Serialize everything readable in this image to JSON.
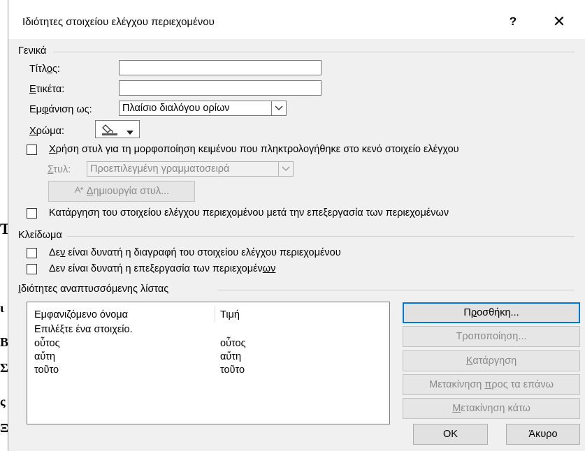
{
  "dialog": {
    "title": "Ιδιότητες στοιχείου ελέγχου περιεχομένου",
    "help_glyph": "?",
    "close_glyph": "✕"
  },
  "general": {
    "section_label": "Γενικά",
    "title_label_pre": "Τίτλ",
    "title_label_ul": "ο",
    "title_label_post": "ς:",
    "title_value": "",
    "tag_label_ul": "Ε",
    "tag_label_post": "τικέτα:",
    "tag_value": "",
    "show_as_label_pre": "Εμ",
    "show_as_label_ul": "φ",
    "show_as_label_post": "άνιση ως:",
    "show_as_value": "Πλαίσιο διαλόγου ορίων",
    "color_label_ul": "Χ",
    "color_label_post": "ρώμα:",
    "use_style_pre": "",
    "use_style_ul": "Χ",
    "use_style_post": "ρήση στυλ για τη μορφοποίηση κειμένου που πληκτρολογήθηκε στο κενό στοιχείο ελέγχου",
    "style_label_ul": "Σ",
    "style_label_post": "τυλ:",
    "style_value": "Προεπιλεγμένη γραμματοσειρά",
    "new_style_pre": "",
    "new_style_ul": "Δ",
    "new_style_post": "ημιουργία στυλ...",
    "remove_after_edit": "Κατάργηση του στοιχείου ελέγχου περιεχομένου μετά την επεξεργασία των περιεχομένων"
  },
  "locking": {
    "section_label": "Κλείδωμα",
    "no_delete_pre": "Δε",
    "no_delete_ul": "ν",
    "no_delete_post": " είναι δυνατή η διαγραφή του στοιχείου ελέγχου περιεχομένου",
    "no_edit_pre": "Δεν είναι δυνατή η επεξεργασία των περιεχομέν",
    "no_edit_ul": "ων",
    "no_edit_post": ""
  },
  "dropdown": {
    "section_label_ul": "Ι",
    "section_label_post": "διότητες αναπτυσσόμενης λίστας",
    "col_display": "Εμφανιζόμενο όνομα",
    "col_value": "Τιμή",
    "rows": [
      {
        "display": "Επιλέξτε ένα στοιχείο.",
        "value": ""
      },
      {
        "display": "οὗτος",
        "value": "οὗτος"
      },
      {
        "display": "αὕτη",
        "value": "αὕτη"
      },
      {
        "display": "τοῦτο",
        "value": "τοῦτο"
      }
    ],
    "add_pre": "Π",
    "add_ul": "ρ",
    "add_post": "οσθήκη...",
    "modify_pre": "Τροποποίηση",
    "modify_ul": "",
    "modify_post": "...",
    "remove_ul": "Κ",
    "remove_post": "ατάργηση",
    "move_up_pre": "Μετακίνηση ",
    "move_up_ul": "π",
    "move_up_post": "ρος τα επάνω",
    "move_down_ul": "Μ",
    "move_down_post": "ετακίνηση κάτω"
  },
  "footer": {
    "ok": "OK",
    "cancel": "Άκυρο"
  },
  "background_doc": {
    "frag1": "T",
    "frag2": "ι",
    "frag3": "Β",
    "frag4": "Σ",
    "frag5": "ς",
    "frag6": "Ξ"
  }
}
